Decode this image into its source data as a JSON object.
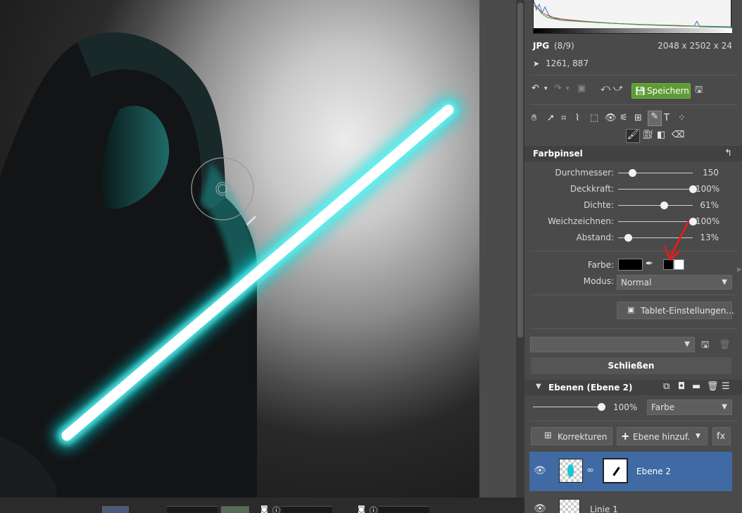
{
  "image_info": {
    "format": "JPG",
    "index": "(8/9)",
    "dimensions": "2048 x 2502 x 24",
    "cursor_position": "1261, 887"
  },
  "toolbar": {
    "save_label": "Speichern"
  },
  "brush_panel": {
    "title": "Farbpinsel",
    "sliders": [
      {
        "label": "Durchmesser:",
        "value": "150",
        "level": 0.19
      },
      {
        "label": "Deckkraft:",
        "value": "100%",
        "level": 1.0
      },
      {
        "label": "Dichte:",
        "value": "61%",
        "level": 0.61
      },
      {
        "label": "Weichzeichnen:",
        "value": "100%",
        "level": 1.0
      },
      {
        "label": "Abstand:",
        "value": "13%",
        "level": 0.13
      }
    ],
    "color_label": "Farbe:",
    "mode_label": "Modus:",
    "mode_value": "Normal",
    "tablet_button": "Tablet-Einstellungen..."
  },
  "close_button": "Schließen",
  "layers": {
    "title": "Ebenen (Ebene 2)",
    "opacity_value": "100%",
    "opacity_level": 1.0,
    "blend_mode": "Farbe",
    "corrections_button": "Korrekturen",
    "add_layer_button": "Ebene hinzuf...",
    "fx_button": "fx",
    "items": [
      {
        "name": "Ebene 2",
        "selected": true
      },
      {
        "name": "Linie 1",
        "selected": false
      }
    ]
  },
  "colors": {
    "accent_green": "#5d9c34",
    "selected_layer": "#3f6aa3",
    "saber_glow": "#00e5e5",
    "annotation_arrow": "#e41b1b"
  }
}
